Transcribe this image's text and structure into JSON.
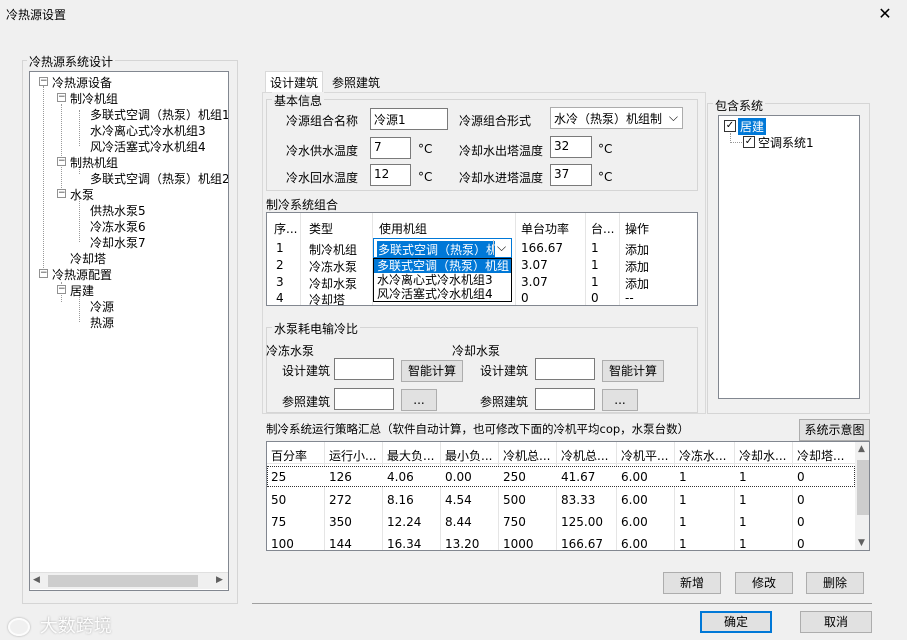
{
  "window": {
    "title": "冷热源设置",
    "close_glyph": "✕"
  },
  "left_group": {
    "title": "冷热源系统设计"
  },
  "tree": {
    "root": "冷热源设备",
    "cooling_group": "制冷机组",
    "cooling_items": [
      "多联式空调（热泵）机组1",
      "水冷离心式冷水机组3",
      "风冷活塞式冷水机组4"
    ],
    "heating_group": "制热机组",
    "heating_items": [
      "多联式空调（热泵）机组2"
    ],
    "pump_group": "水泵",
    "pump_items": [
      "供热水泵5",
      "冷冻水泵6",
      "冷却水泵7"
    ],
    "tower": "冷却塔",
    "config_root": "冷热源配置",
    "building": "居建",
    "building_items": [
      "冷源",
      "热源"
    ],
    "expander_minus": "−",
    "scroll_left": "◀",
    "scroll_right": "▶"
  },
  "tabs": [
    {
      "label": "设计建筑"
    },
    {
      "label": "参照建筑"
    }
  ],
  "basic_info": {
    "title": "基本信息",
    "source_name_label": "冷源组合名称",
    "source_name_value": "冷源1",
    "source_form_label": "冷源组合形式",
    "source_form_value": "水冷（热泵）机组制",
    "chilled_supply_label": "冷水供水温度",
    "chilled_supply_value": "7",
    "cooling_out_label": "冷却水出塔温度",
    "cooling_out_value": "32",
    "chilled_return_label": "冷水回水温度",
    "chilled_return_value": "12",
    "cooling_in_label": "冷却水进塔温度",
    "cooling_in_value": "37",
    "unit": "°C",
    "chevron": "⌵"
  },
  "cooling_combo": {
    "title": "制冷系统组合",
    "headers": [
      "序...",
      "类型",
      "使用机组",
      "单台功率",
      "台...",
      "操作"
    ],
    "rows": [
      [
        "1",
        "制冷机组",
        "多联式空调（热泵）机",
        "166.67",
        "1",
        "添加"
      ],
      [
        "2",
        "冷冻水泵",
        "",
        "3.07",
        "1",
        "添加"
      ],
      [
        "3",
        "冷却水泵",
        "",
        "3.07",
        "1",
        "添加"
      ],
      [
        "4",
        "冷却塔",
        "",
        "0",
        "0",
        "--"
      ]
    ],
    "dropdown_options": [
      "多联式空调（热泵）机组",
      "水冷离心式冷水机组3",
      "风冷活塞式冷水机组4"
    ]
  },
  "pump_ratio": {
    "title": "水泵耗电输冷比",
    "chilled_title": "冷冻水泵",
    "cooling_title": "冷却水泵",
    "design_label": "设计建筑",
    "reference_label": "参照建筑",
    "smart_calc": "智能计算",
    "ellipsis": "..."
  },
  "include_system": {
    "title": "包含系统",
    "building": "居建",
    "system": "空调系统1",
    "check": "✓"
  },
  "strategy": {
    "title": "制冷系统运行策略汇总（软件自动计算，也可修改下面的冷机平均cop，水泵台数）",
    "diagram_button": "系统示意图",
    "headers": [
      "百分率",
      "运行小...",
      "最大负...",
      "最小负...",
      "冷机总...",
      "冷机总...",
      "冷机平...",
      "冷冻水...",
      "冷却水...",
      "冷却塔..."
    ],
    "rows": [
      [
        "25",
        "126",
        "4.06",
        "0.00",
        "250",
        "41.67",
        "6.00",
        "1",
        "1",
        "0"
      ],
      [
        "50",
        "272",
        "8.16",
        "4.54",
        "500",
        "83.33",
        "6.00",
        "1",
        "1",
        "0"
      ],
      [
        "75",
        "350",
        "12.24",
        "8.44",
        "750",
        "125.00",
        "6.00",
        "1",
        "1",
        "0"
      ],
      [
        "100",
        "144",
        "16.34",
        "13.20",
        "1000",
        "166.67",
        "6.00",
        "1",
        "1",
        "0"
      ]
    ],
    "scroll_up": "▲",
    "scroll_down": "▼"
  },
  "actions": {
    "add": "新增",
    "modify": "修改",
    "delete": "删除"
  },
  "footer": {
    "ok": "确定",
    "cancel": "取消",
    "watermark": "大数跨境"
  }
}
